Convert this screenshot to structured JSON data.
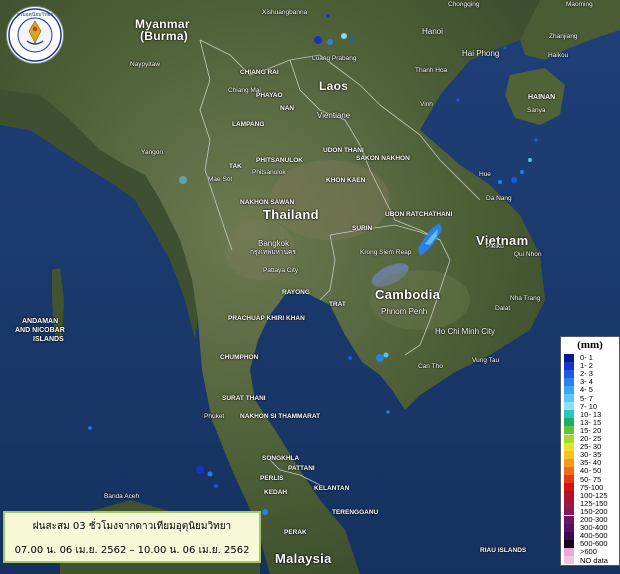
{
  "title": "ฝนสะสม 03 ชั่วโมงจากดาวเทียมอุตุนิยมวิทยา",
  "time_range": "07.00 น. 06 เม.ย. 2562 – 10.00 น. 06 เม.ย. 2562",
  "legend": {
    "unit": "(mm)",
    "classes": [
      {
        "label": "0- 1",
        "color": "#0a1a8c"
      },
      {
        "label": "1- 2",
        "color": "#1733c8"
      },
      {
        "label": "2- 3",
        "color": "#1f5ae6"
      },
      {
        "label": "3- 4",
        "color": "#2a82ef"
      },
      {
        "label": "4- 5",
        "color": "#38a8f3"
      },
      {
        "label": "5- 7",
        "color": "#5cc8f5"
      },
      {
        "label": "7- 10",
        "color": "#8fe0f2"
      },
      {
        "label": "10- 13",
        "color": "#2cc6c0"
      },
      {
        "label": "13- 15",
        "color": "#1fae6a"
      },
      {
        "label": "15- 20",
        "color": "#5fc43a"
      },
      {
        "label": "20- 25",
        "color": "#a7d92a"
      },
      {
        "label": "25- 30",
        "color": "#e6e32a"
      },
      {
        "label": "30- 35",
        "color": "#f5c21f"
      },
      {
        "label": "35- 40",
        "color": "#f59a1a"
      },
      {
        "label": "40- 50",
        "color": "#f06e17"
      },
      {
        "label": "50- 75",
        "color": "#e53a14"
      },
      {
        "label": "75-100",
        "color": "#d01414"
      },
      {
        "label": "100-125",
        "color": "#b3102a"
      },
      {
        "label": "125-150",
        "color": "#a01840"
      },
      {
        "label": "150-200",
        "color": "#8a1a55"
      },
      {
        "label": "200-300",
        "color": "#6e1462"
      },
      {
        "label": "300-400",
        "color": "#55106a"
      },
      {
        "label": "400-500",
        "color": "#3a0a55"
      },
      {
        "label": "500-600",
        "color": "#1a0520"
      },
      {
        "label": ">600",
        "color": "#e9a8d6"
      },
      {
        "label": "NO data",
        "color": "#f2c4e2"
      }
    ]
  },
  "labels": {
    "countries": {
      "myanmar": "Myanmar",
      "burma": "(Burma)",
      "laos": "Laos",
      "thailand": "Thailand",
      "cambodia": "Cambodia",
      "vietnam": "Vietnam",
      "malaysia": "Malaysia",
      "andaman": "ANDAMAN",
      "nicobar": "AND NICOBAR",
      "islands": "ISLANDS",
      "hainan": "HAINAN"
    },
    "cities": {
      "xishuangbanna": "Xishuangbanna",
      "chongqing": "Chongqing",
      "hanoi": "Hanoi",
      "hai_phong": "Hai Phong",
      "thanh_hoa": "Thanh Hoa",
      "vinh": "Vinh",
      "zhanjiang": "Zhanjiang",
      "haikou": "Haikou",
      "sanya": "Sanya",
      "maoming": "Maoming",
      "naypyitaw": "Naypyitaw",
      "chiang_rai": "CHIANG RAI",
      "chiang_mai": "Chiang Mai",
      "phayao": "PHAYAO",
      "nan": "NAN",
      "lampang": "LAMPANG",
      "luang_prabang": "Luang Prabang",
      "vientiane": "Vientiane",
      "yangon": "Yangon",
      "tak": "TAK",
      "phitsanulok_up": "PHITSANULOK",
      "phitsanulok": "Phitsanulok",
      "mae_sot": "Mae Sot",
      "udon_thani": "UDON THANI",
      "sakon_nakhon": "SAKON NAKHON",
      "khon_kaen": "KHON KAEN",
      "nakhon_sawan": "NAKHON SAWAN",
      "hue": "Hue",
      "da_nang": "Da Nang",
      "ubon_ratchathani": "UBON RATCHATHANI",
      "surin": "SURIN",
      "bangkok": "Bangkok",
      "bangkok_th": "กรุงเทพมหานคร",
      "krong_siem_reap": "Krong Siem Reap",
      "pattaya_city": "Pattaya City",
      "rayong": "RAYONG",
      "trat": "TRAT",
      "pleiku": "Pleiku",
      "qui_nhon": "Qui Nhon",
      "nha_trang": "Nha Trang",
      "dalat": "Dalat",
      "phnom_penh": "Phnom Penh",
      "ho_chi_minh": "Ho Chi Minh City",
      "vung_tau": "Vung Tau",
      "can_tho": "Can Tho",
      "prachuap": "PRACHUAP KHIRI KHAN",
      "chumphon": "CHUMPHON",
      "surat_thani": "SURAT THANI",
      "phuket": "Phuket",
      "nakhon_si": "NAKHON SI THAMMARAT",
      "songkhla": "SONGKHLA",
      "pattani": "PATTANI",
      "perlis": "PERLIS",
      "kelantan": "KELANTAN",
      "kedah": "KEDAH",
      "terengganu": "TERENGGANU",
      "perak": "PERAK",
      "banda_aceh": "Banda Aceh",
      "riau_islands": "RIAU ISLANDS"
    }
  },
  "logo_text": "กรมอุตุนิยมวิทยา"
}
